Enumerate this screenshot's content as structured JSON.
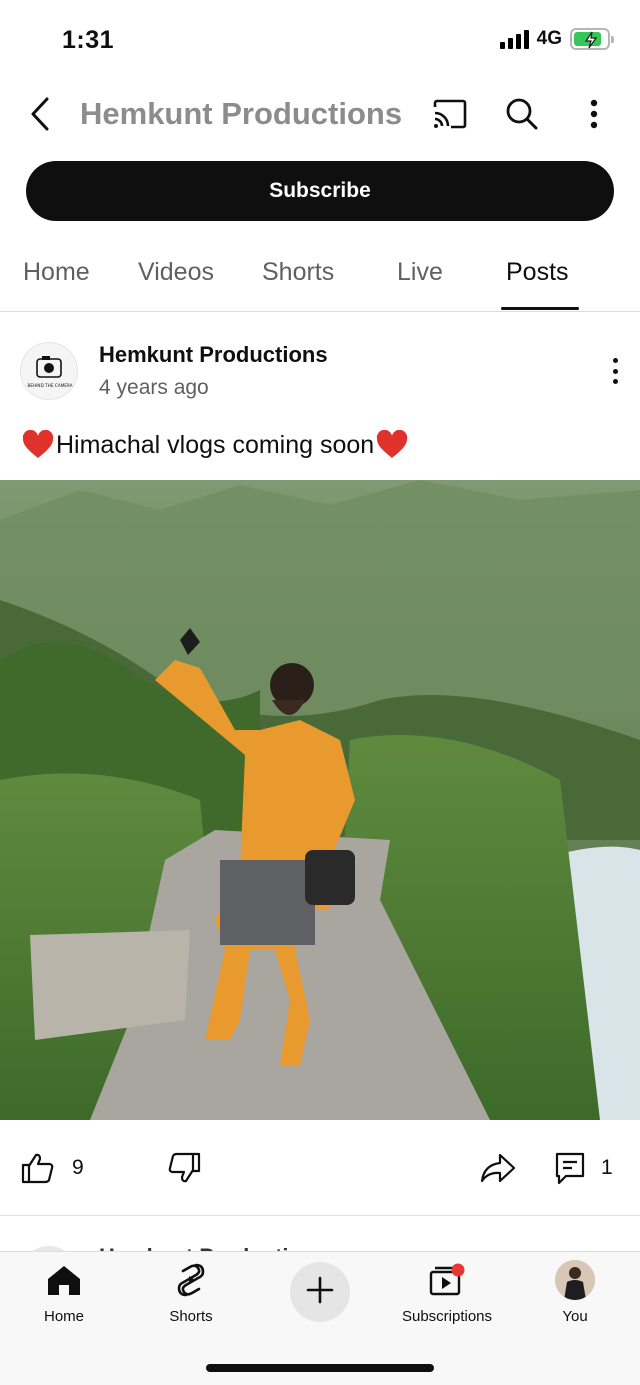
{
  "status_bar": {
    "time": "1:31",
    "network": "4G",
    "battery_charging": true,
    "battery_level": 0.85
  },
  "top_bar": {
    "channel_title": "Hemkunt Productions",
    "icons": [
      "back-icon",
      "cast-icon",
      "search-icon",
      "more-vertical-icon"
    ]
  },
  "subscribe_label": "Subscribe",
  "tabs": [
    {
      "label": "Home"
    },
    {
      "label": "Videos"
    },
    {
      "label": "Shorts"
    },
    {
      "label": "Live"
    },
    {
      "label": "Posts",
      "active": true
    }
  ],
  "post": {
    "author": "Hemkunt Productions",
    "time_ago": "4 years ago",
    "text": "Himachal vlogs coming soon",
    "avatar_logo_text": "BEHIND THE CAMERA",
    "likes": "9",
    "comments": "1"
  },
  "next_post": {
    "author": "Hemkunt Productions"
  },
  "bottom_nav": {
    "items": [
      {
        "label": "Home",
        "icon": "home-icon"
      },
      {
        "label": "Shorts",
        "icon": "shorts-icon"
      },
      {
        "label": "",
        "icon": "plus-icon"
      },
      {
        "label": "Subscriptions",
        "icon": "subscriptions-icon"
      },
      {
        "label": "You",
        "icon": "avatar"
      }
    ]
  },
  "colors": {
    "subscribe_bg": "#0f0f0f",
    "battery_green": "#35c759",
    "notification_dot": "#e53935",
    "title_grey": "#8c8c8c"
  }
}
